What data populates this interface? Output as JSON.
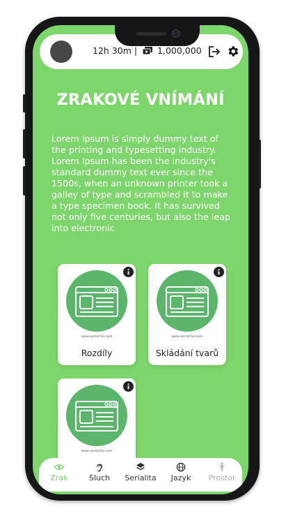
{
  "status": {
    "time": "12h 30m |",
    "coins": "1,000,000"
  },
  "page": {
    "title": "ZRAKOVÉ VNÍMÁNÍ",
    "description": "Lorem Ipsum is simply dummy text of the printing and typesetting industry. Lorem Ipsum has been the industry's standard dummy text ever since the 1500s, when an unknown printer took a galley of type and scrambled it to make a type specimen book. It has survived not only five centuries, but also the leap into electronic"
  },
  "cards": [
    {
      "label": "Rozdíly",
      "credit": "www.vectorfair.com"
    },
    {
      "label": "Skládání tvarů",
      "credit": "www.vectorfair.com"
    },
    {
      "label": "",
      "credit": "www.vectorfair.com"
    }
  ],
  "nav": [
    {
      "label": "Zrak",
      "icon": "eye-icon",
      "state": "active"
    },
    {
      "label": "Sluch",
      "icon": "ear-icon",
      "state": "normal"
    },
    {
      "label": "Serialita",
      "icon": "layers-icon",
      "state": "normal"
    },
    {
      "label": "Jazyk",
      "icon": "globe-icon",
      "state": "normal"
    },
    {
      "label": "Prostor",
      "icon": "figure-icon",
      "state": "disabled"
    }
  ],
  "colors": {
    "accent": "#7dd66b",
    "circle": "#5bb56a",
    "inactive": "#aaaaaa"
  }
}
